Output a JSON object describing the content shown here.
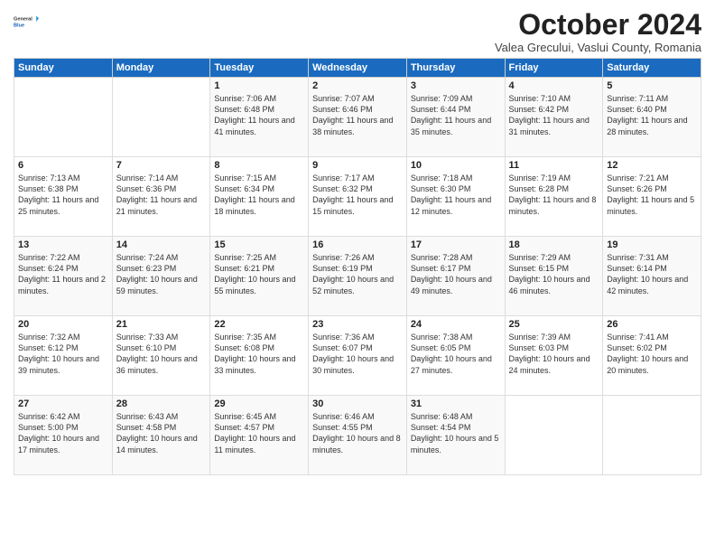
{
  "header": {
    "logo_general": "General",
    "logo_blue": "Blue",
    "month_title": "October 2024",
    "subtitle": "Valea Grecului, Vaslui County, Romania"
  },
  "days_of_week": [
    "Sunday",
    "Monday",
    "Tuesday",
    "Wednesday",
    "Thursday",
    "Friday",
    "Saturday"
  ],
  "weeks": [
    [
      {
        "day": "",
        "content": ""
      },
      {
        "day": "",
        "content": ""
      },
      {
        "day": "1",
        "content": "Sunrise: 7:06 AM\nSunset: 6:48 PM\nDaylight: 11 hours and 41 minutes."
      },
      {
        "day": "2",
        "content": "Sunrise: 7:07 AM\nSunset: 6:46 PM\nDaylight: 11 hours and 38 minutes."
      },
      {
        "day": "3",
        "content": "Sunrise: 7:09 AM\nSunset: 6:44 PM\nDaylight: 11 hours and 35 minutes."
      },
      {
        "day": "4",
        "content": "Sunrise: 7:10 AM\nSunset: 6:42 PM\nDaylight: 11 hours and 31 minutes."
      },
      {
        "day": "5",
        "content": "Sunrise: 7:11 AM\nSunset: 6:40 PM\nDaylight: 11 hours and 28 minutes."
      }
    ],
    [
      {
        "day": "6",
        "content": "Sunrise: 7:13 AM\nSunset: 6:38 PM\nDaylight: 11 hours and 25 minutes."
      },
      {
        "day": "7",
        "content": "Sunrise: 7:14 AM\nSunset: 6:36 PM\nDaylight: 11 hours and 21 minutes."
      },
      {
        "day": "8",
        "content": "Sunrise: 7:15 AM\nSunset: 6:34 PM\nDaylight: 11 hours and 18 minutes."
      },
      {
        "day": "9",
        "content": "Sunrise: 7:17 AM\nSunset: 6:32 PM\nDaylight: 11 hours and 15 minutes."
      },
      {
        "day": "10",
        "content": "Sunrise: 7:18 AM\nSunset: 6:30 PM\nDaylight: 11 hours and 12 minutes."
      },
      {
        "day": "11",
        "content": "Sunrise: 7:19 AM\nSunset: 6:28 PM\nDaylight: 11 hours and 8 minutes."
      },
      {
        "day": "12",
        "content": "Sunrise: 7:21 AM\nSunset: 6:26 PM\nDaylight: 11 hours and 5 minutes."
      }
    ],
    [
      {
        "day": "13",
        "content": "Sunrise: 7:22 AM\nSunset: 6:24 PM\nDaylight: 11 hours and 2 minutes."
      },
      {
        "day": "14",
        "content": "Sunrise: 7:24 AM\nSunset: 6:23 PM\nDaylight: 10 hours and 59 minutes."
      },
      {
        "day": "15",
        "content": "Sunrise: 7:25 AM\nSunset: 6:21 PM\nDaylight: 10 hours and 55 minutes."
      },
      {
        "day": "16",
        "content": "Sunrise: 7:26 AM\nSunset: 6:19 PM\nDaylight: 10 hours and 52 minutes."
      },
      {
        "day": "17",
        "content": "Sunrise: 7:28 AM\nSunset: 6:17 PM\nDaylight: 10 hours and 49 minutes."
      },
      {
        "day": "18",
        "content": "Sunrise: 7:29 AM\nSunset: 6:15 PM\nDaylight: 10 hours and 46 minutes."
      },
      {
        "day": "19",
        "content": "Sunrise: 7:31 AM\nSunset: 6:14 PM\nDaylight: 10 hours and 42 minutes."
      }
    ],
    [
      {
        "day": "20",
        "content": "Sunrise: 7:32 AM\nSunset: 6:12 PM\nDaylight: 10 hours and 39 minutes."
      },
      {
        "day": "21",
        "content": "Sunrise: 7:33 AM\nSunset: 6:10 PM\nDaylight: 10 hours and 36 minutes."
      },
      {
        "day": "22",
        "content": "Sunrise: 7:35 AM\nSunset: 6:08 PM\nDaylight: 10 hours and 33 minutes."
      },
      {
        "day": "23",
        "content": "Sunrise: 7:36 AM\nSunset: 6:07 PM\nDaylight: 10 hours and 30 minutes."
      },
      {
        "day": "24",
        "content": "Sunrise: 7:38 AM\nSunset: 6:05 PM\nDaylight: 10 hours and 27 minutes."
      },
      {
        "day": "25",
        "content": "Sunrise: 7:39 AM\nSunset: 6:03 PM\nDaylight: 10 hours and 24 minutes."
      },
      {
        "day": "26",
        "content": "Sunrise: 7:41 AM\nSunset: 6:02 PM\nDaylight: 10 hours and 20 minutes."
      }
    ],
    [
      {
        "day": "27",
        "content": "Sunrise: 6:42 AM\nSunset: 5:00 PM\nDaylight: 10 hours and 17 minutes."
      },
      {
        "day": "28",
        "content": "Sunrise: 6:43 AM\nSunset: 4:58 PM\nDaylight: 10 hours and 14 minutes."
      },
      {
        "day": "29",
        "content": "Sunrise: 6:45 AM\nSunset: 4:57 PM\nDaylight: 10 hours and 11 minutes."
      },
      {
        "day": "30",
        "content": "Sunrise: 6:46 AM\nSunset: 4:55 PM\nDaylight: 10 hours and 8 minutes."
      },
      {
        "day": "31",
        "content": "Sunrise: 6:48 AM\nSunset: 4:54 PM\nDaylight: 10 hours and 5 minutes."
      },
      {
        "day": "",
        "content": ""
      },
      {
        "day": "",
        "content": ""
      }
    ]
  ]
}
